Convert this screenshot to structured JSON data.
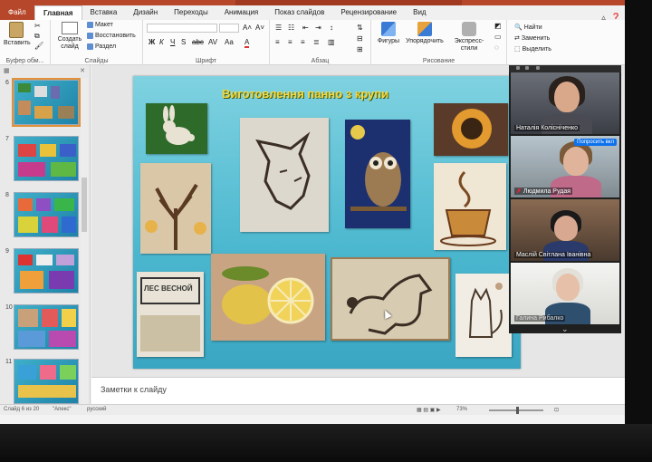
{
  "ribbon_tabs": {
    "file": "Файл",
    "home": "Главная",
    "insert": "Вставка",
    "design": "Дизайн",
    "transitions": "Переходы",
    "animations": "Анимация",
    "slideshow": "Показ слайдов",
    "review": "Рецензирование",
    "view": "Вид"
  },
  "ribbon": {
    "clipboard": {
      "paste": "Вставить",
      "group_label": "Буфер обм..."
    },
    "slides": {
      "new_slide": "Создать слайд",
      "layout": "Макет",
      "reset": "Восстановить",
      "section": "Раздел",
      "group_label": "Слайды"
    },
    "font": {
      "group_label": "Шрифт"
    },
    "paragraph": {
      "group_label": "Абзац"
    },
    "drawing": {
      "shapes": "Фигуры",
      "arrange": "Упорядочить",
      "quick_styles": "Экспресс-стили",
      "group_label": "Рисование"
    },
    "editing": {
      "find": "Найти",
      "replace": "Заменить",
      "select": "Выделить"
    }
  },
  "thumbnails": {
    "items": [
      {
        "num": "6"
      },
      {
        "num": "7"
      },
      {
        "num": "8"
      },
      {
        "num": "9"
      },
      {
        "num": "10"
      },
      {
        "num": "11"
      }
    ]
  },
  "slide": {
    "title": "Виготовлення панно з крупи",
    "artwork_sign": "ЛЕС ВЕСНОЙ"
  },
  "notes": {
    "placeholder": "Заметки к слайду"
  },
  "status": {
    "slide_counter": "Слайд 6 из 20",
    "theme": "\"Апекс\"",
    "language": "русский",
    "zoom": "73%"
  },
  "video": {
    "participants": [
      {
        "name": "Наталія Колісніченко",
        "muted": false
      },
      {
        "name": "Людмила Рудая",
        "muted": true,
        "button": "Попросить вкл"
      },
      {
        "name": "Маслій Світлана Іванівна",
        "muted": false
      },
      {
        "name": "Галина Рибалко",
        "muted": false
      }
    ]
  },
  "colors": {
    "accent": "#b7472a",
    "slide_title": "#f6d63b",
    "zoom_button": "#0e72ed"
  }
}
